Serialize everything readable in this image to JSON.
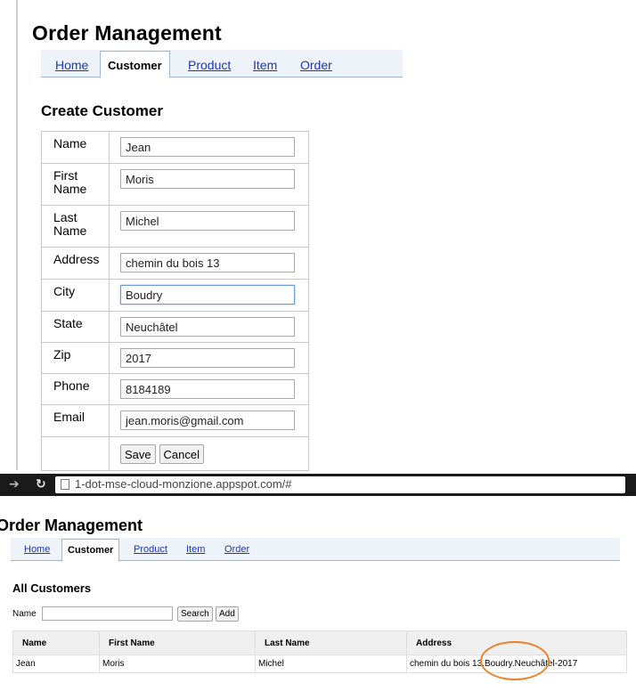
{
  "create_page": {
    "title": "Order Management",
    "tabs": [
      {
        "label": "Home",
        "active": false
      },
      {
        "label": "Customer",
        "active": true
      },
      {
        "label": "Product",
        "active": false
      },
      {
        "label": "Item",
        "active": false
      },
      {
        "label": "Order",
        "active": false
      }
    ],
    "heading": "Create Customer",
    "fields": [
      {
        "label": "Name",
        "value": "Jean"
      },
      {
        "label": "First Name",
        "value": "Moris"
      },
      {
        "label": "Last Name",
        "value": "Michel"
      },
      {
        "label": "Address",
        "value": "chemin du bois 13"
      },
      {
        "label": "City",
        "value": "Boudry"
      },
      {
        "label": "State",
        "value": "Neuchâtel"
      },
      {
        "label": "Zip",
        "value": "2017"
      },
      {
        "label": "Phone",
        "value": "8184189"
      },
      {
        "label": "Email",
        "value": "jean.moris@gmail.com"
      }
    ],
    "save_label": "Save",
    "cancel_label": "Cancel"
  },
  "browser": {
    "url": "1-dot-mse-cloud-monzione.appspot.com/#"
  },
  "list_page": {
    "title": "Order Management",
    "tabs": [
      {
        "label": "Home",
        "active": false
      },
      {
        "label": "Customer",
        "active": true
      },
      {
        "label": "Product",
        "active": false
      },
      {
        "label": "Item",
        "active": false
      },
      {
        "label": "Order",
        "active": false
      }
    ],
    "heading": "All Customers",
    "search_label": "Name",
    "search_value": "",
    "search_button": "Search",
    "add_button": "Add",
    "columns": [
      "Name",
      "First Name",
      "Last Name",
      "Address"
    ],
    "rows": [
      {
        "name": "Jean",
        "first_name": "Moris",
        "last_name": "Michel",
        "address": "chemin du bois 13.Boudry.Neuchâtel-2017"
      }
    ]
  },
  "colors": {
    "link": "#1a37b8",
    "tab_bar": "#eef3fa",
    "annotation": "#e8842a"
  }
}
